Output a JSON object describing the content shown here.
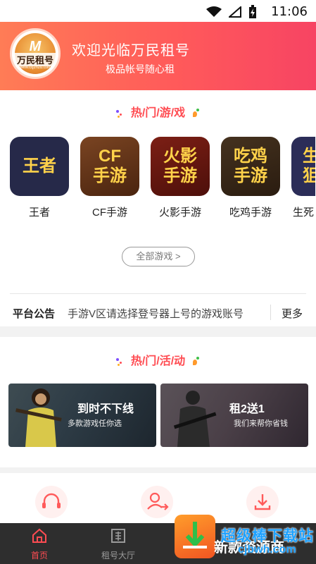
{
  "status_bar": {
    "time": "11:06",
    "icons": [
      "wifi-icon",
      "signal-icon",
      "battery-icon"
    ]
  },
  "header": {
    "logo_text": "万民租号",
    "logo_url": "www.cqzhzu.com",
    "welcome": "欢迎光临万民租号",
    "slogan": "极品帐号随心租"
  },
  "hot_games": {
    "title": "热/门/游/戏",
    "items": [
      {
        "tile": "王者",
        "label": "王者",
        "bg": "#2b2d4a"
      },
      {
        "tile": "CF\n手游",
        "label": "CF手游",
        "bg": "#6a3a1e"
      },
      {
        "tile": "火影\n手游",
        "label": "火影手游",
        "bg": "#6b1b14"
      },
      {
        "tile": "吃鸡\n手游",
        "label": "吃鸡手游",
        "bg": "#3a2a1c"
      },
      {
        "tile": "生\n狙",
        "label": "生死",
        "bg": "#2b2d55"
      }
    ],
    "all_games_label": "全部游戏 >"
  },
  "notice": {
    "tag": "平台公告",
    "message": "手游V区请选择登号器上号的游戏账号",
    "more": "更多"
  },
  "hot_activities": {
    "title": "热/门/活/动",
    "banners": [
      {
        "title": "到时不下线",
        "subtitle": "多款游戏任你选"
      },
      {
        "title": "租2送1",
        "subtitle": "我们来帮你省钱"
      }
    ]
  },
  "services": {
    "icons": [
      "headset-icon",
      "transfer-user-icon",
      "download-icon"
    ]
  },
  "tabbar": {
    "tabs": [
      {
        "label": "首页",
        "active": true
      },
      {
        "label": "租号大厅",
        "active": false
      }
    ],
    "active_color": "#ff4c52"
  },
  "watermark": {
    "title": "超级棒下载站",
    "url": "cjbwh.com",
    "underlying": "新款资源商"
  },
  "colors": {
    "accent": "#ff4c52",
    "header_start": "#ff7c56",
    "header_end": "#f74463"
  }
}
